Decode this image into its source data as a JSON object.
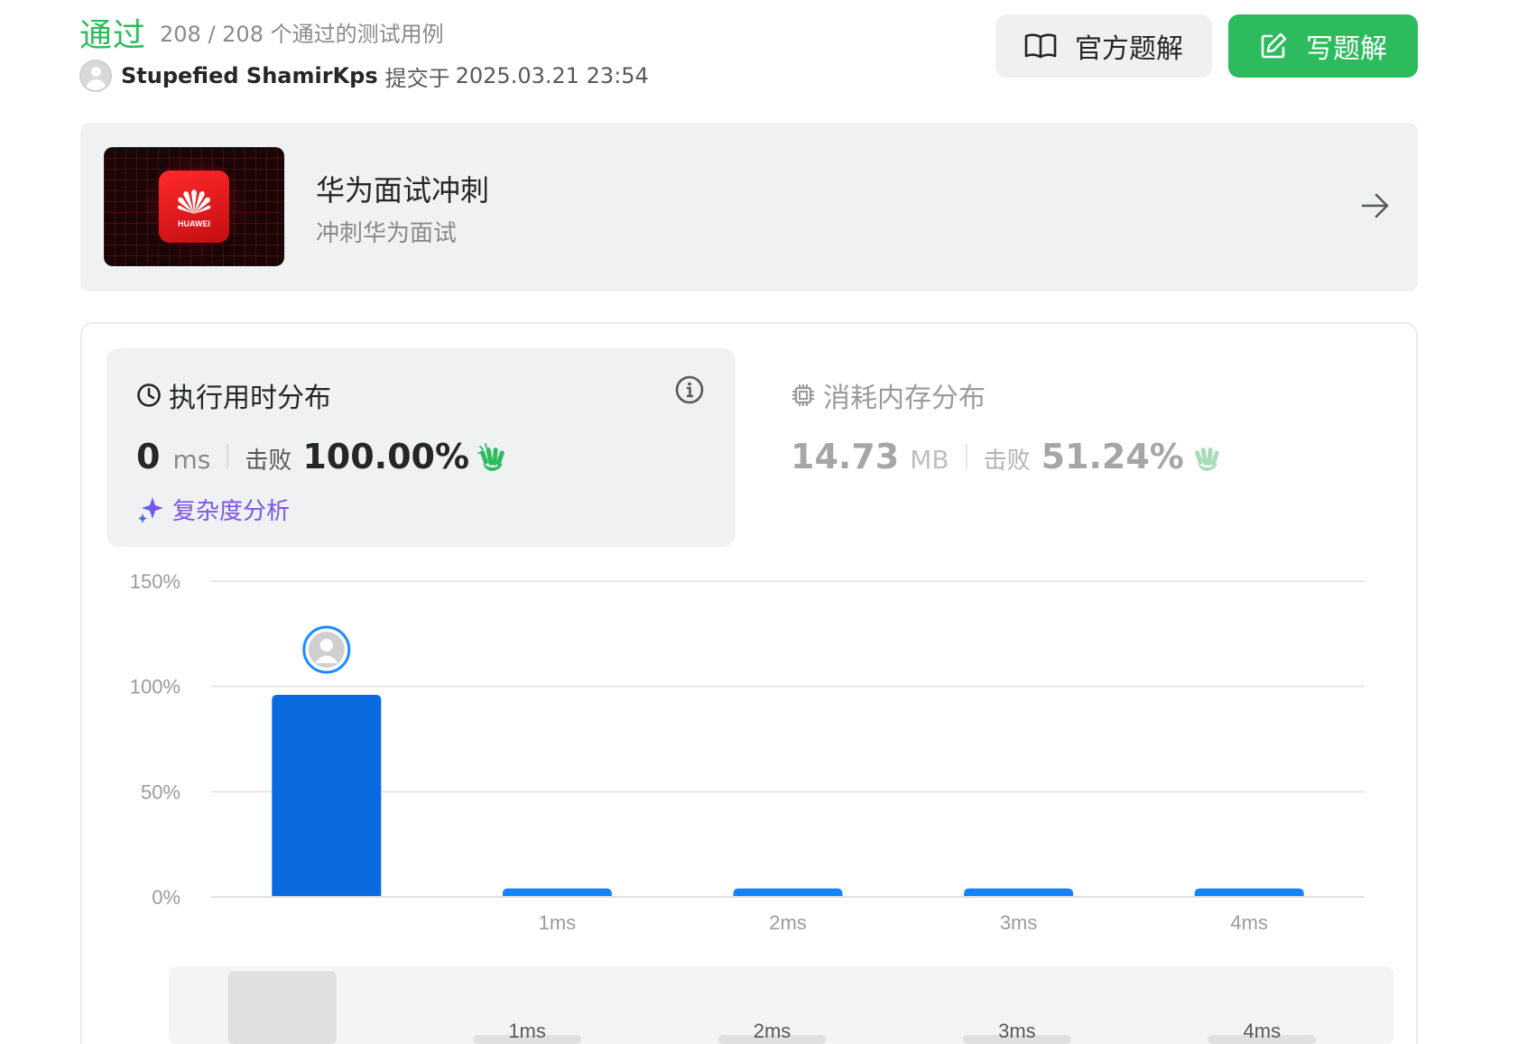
{
  "header": {
    "status": "通过",
    "cases": "208 / 208 个通过的测试用例",
    "username": "Stupefied ShamirKps",
    "submit_label": "提交于",
    "submit_time": "2025.03.21 23:54",
    "official_solution_label": "官方题解",
    "write_solution_label": "写题解"
  },
  "banner": {
    "title": "华为面试冲刺",
    "subtitle": "冲刺华为面试",
    "logo_text": "HUAWEI"
  },
  "runtime": {
    "title": "执行用时分布",
    "value": "0",
    "unit": "ms",
    "beat_label": "击败",
    "beat_value": "100.00%",
    "complexity_label": "复杂度分析"
  },
  "memory": {
    "title": "消耗内存分布",
    "value": "14.73",
    "unit": "MB",
    "beat_label": "击败",
    "beat_value": "51.24%"
  },
  "colors": {
    "accepted": "#2cbb5d",
    "bar": "#0a6be0",
    "bar_light": "#1583ff",
    "complexity": "#7b57e6"
  },
  "chart_data": {
    "type": "bar",
    "categories": [
      "0ms",
      "1ms",
      "2ms",
      "3ms",
      "4ms"
    ],
    "x_tick_labels": [
      "",
      "1ms",
      "2ms",
      "3ms",
      "4ms"
    ],
    "values": [
      96,
      4,
      4,
      4,
      4
    ],
    "ylim": [
      0,
      150
    ],
    "y_ticks": [
      "0%",
      "50%",
      "100%",
      "150%"
    ],
    "y_tick_values": [
      0,
      50,
      100,
      150
    ],
    "highlight_index": 0,
    "grid": true,
    "brush": {
      "labels": [
        "1ms",
        "2ms",
        "3ms",
        "4ms"
      ]
    }
  }
}
